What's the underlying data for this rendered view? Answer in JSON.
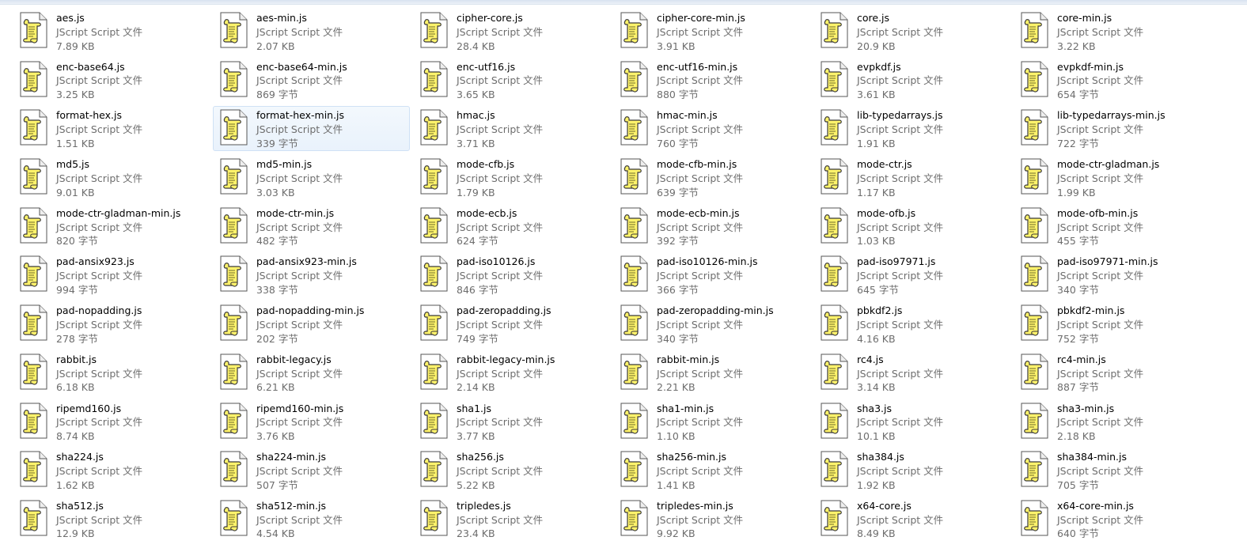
{
  "window": {
    "view": "tiles",
    "selected_index": 13
  },
  "files": [
    {
      "name": "aes.js",
      "type": "JScript Script 文件",
      "size": "7.89 KB"
    },
    {
      "name": "aes-min.js",
      "type": "JScript Script 文件",
      "size": "2.07 KB"
    },
    {
      "name": "cipher-core.js",
      "type": "JScript Script 文件",
      "size": "28.4 KB"
    },
    {
      "name": "cipher-core-min.js",
      "type": "JScript Script 文件",
      "size": "3.91 KB"
    },
    {
      "name": "core.js",
      "type": "JScript Script 文件",
      "size": "20.9 KB"
    },
    {
      "name": "core-min.js",
      "type": "JScript Script 文件",
      "size": "3.22 KB"
    },
    {
      "name": "enc-base64.js",
      "type": "JScript Script 文件",
      "size": "3.25 KB"
    },
    {
      "name": "enc-base64-min.js",
      "type": "JScript Script 文件",
      "size": "869 字节"
    },
    {
      "name": "enc-utf16.js",
      "type": "JScript Script 文件",
      "size": "3.65 KB"
    },
    {
      "name": "enc-utf16-min.js",
      "type": "JScript Script 文件",
      "size": "880 字节"
    },
    {
      "name": "evpkdf.js",
      "type": "JScript Script 文件",
      "size": "3.61 KB"
    },
    {
      "name": "evpkdf-min.js",
      "type": "JScript Script 文件",
      "size": "654 字节"
    },
    {
      "name": "format-hex.js",
      "type": "JScript Script 文件",
      "size": "1.51 KB"
    },
    {
      "name": "format-hex-min.js",
      "type": "JScript Script 文件",
      "size": "339 字节"
    },
    {
      "name": "hmac.js",
      "type": "JScript Script 文件",
      "size": "3.71 KB"
    },
    {
      "name": "hmac-min.js",
      "type": "JScript Script 文件",
      "size": "760 字节"
    },
    {
      "name": "lib-typedarrays.js",
      "type": "JScript Script 文件",
      "size": "1.91 KB"
    },
    {
      "name": "lib-typedarrays-min.js",
      "type": "JScript Script 文件",
      "size": "722 字节"
    },
    {
      "name": "md5.js",
      "type": "JScript Script 文件",
      "size": "9.01 KB"
    },
    {
      "name": "md5-min.js",
      "type": "JScript Script 文件",
      "size": "3.03 KB"
    },
    {
      "name": "mode-cfb.js",
      "type": "JScript Script 文件",
      "size": "1.79 KB"
    },
    {
      "name": "mode-cfb-min.js",
      "type": "JScript Script 文件",
      "size": "639 字节"
    },
    {
      "name": "mode-ctr.js",
      "type": "JScript Script 文件",
      "size": "1.17 KB"
    },
    {
      "name": "mode-ctr-gladman.js",
      "type": "JScript Script 文件",
      "size": "1.99 KB"
    },
    {
      "name": "mode-ctr-gladman-min.js",
      "type": "JScript Script 文件",
      "size": "820 字节"
    },
    {
      "name": "mode-ctr-min.js",
      "type": "JScript Script 文件",
      "size": "482 字节"
    },
    {
      "name": "mode-ecb.js",
      "type": "JScript Script 文件",
      "size": "624 字节"
    },
    {
      "name": "mode-ecb-min.js",
      "type": "JScript Script 文件",
      "size": "392 字节"
    },
    {
      "name": "mode-ofb.js",
      "type": "JScript Script 文件",
      "size": "1.03 KB"
    },
    {
      "name": "mode-ofb-min.js",
      "type": "JScript Script 文件",
      "size": "455 字节"
    },
    {
      "name": "pad-ansix923.js",
      "type": "JScript Script 文件",
      "size": "994 字节"
    },
    {
      "name": "pad-ansix923-min.js",
      "type": "JScript Script 文件",
      "size": "338 字节"
    },
    {
      "name": "pad-iso10126.js",
      "type": "JScript Script 文件",
      "size": "846 字节"
    },
    {
      "name": "pad-iso10126-min.js",
      "type": "JScript Script 文件",
      "size": "366 字节"
    },
    {
      "name": "pad-iso97971.js",
      "type": "JScript Script 文件",
      "size": "645 字节"
    },
    {
      "name": "pad-iso97971-min.js",
      "type": "JScript Script 文件",
      "size": "340 字节"
    },
    {
      "name": "pad-nopadding.js",
      "type": "JScript Script 文件",
      "size": "278 字节"
    },
    {
      "name": "pad-nopadding-min.js",
      "type": "JScript Script 文件",
      "size": "202 字节"
    },
    {
      "name": "pad-zeropadding.js",
      "type": "JScript Script 文件",
      "size": "749 字节"
    },
    {
      "name": "pad-zeropadding-min.js",
      "type": "JScript Script 文件",
      "size": "340 字节"
    },
    {
      "name": "pbkdf2.js",
      "type": "JScript Script 文件",
      "size": "4.16 KB"
    },
    {
      "name": "pbkdf2-min.js",
      "type": "JScript Script 文件",
      "size": "752 字节"
    },
    {
      "name": "rabbit.js",
      "type": "JScript Script 文件",
      "size": "6.18 KB"
    },
    {
      "name": "rabbit-legacy.js",
      "type": "JScript Script 文件",
      "size": "6.21 KB"
    },
    {
      "name": "rabbit-legacy-min.js",
      "type": "JScript Script 文件",
      "size": "2.14 KB"
    },
    {
      "name": "rabbit-min.js",
      "type": "JScript Script 文件",
      "size": "2.21 KB"
    },
    {
      "name": "rc4.js",
      "type": "JScript Script 文件",
      "size": "3.14 KB"
    },
    {
      "name": "rc4-min.js",
      "type": "JScript Script 文件",
      "size": "887 字节"
    },
    {
      "name": "ripemd160.js",
      "type": "JScript Script 文件",
      "size": "8.74 KB"
    },
    {
      "name": "ripemd160-min.js",
      "type": "JScript Script 文件",
      "size": "3.76 KB"
    },
    {
      "name": "sha1.js",
      "type": "JScript Script 文件",
      "size": "3.77 KB"
    },
    {
      "name": "sha1-min.js",
      "type": "JScript Script 文件",
      "size": "1.10 KB"
    },
    {
      "name": "sha3.js",
      "type": "JScript Script 文件",
      "size": "10.1 KB"
    },
    {
      "name": "sha3-min.js",
      "type": "JScript Script 文件",
      "size": "2.18 KB"
    },
    {
      "name": "sha224.js",
      "type": "JScript Script 文件",
      "size": "1.62 KB"
    },
    {
      "name": "sha224-min.js",
      "type": "JScript Script 文件",
      "size": "507 字节"
    },
    {
      "name": "sha256.js",
      "type": "JScript Script 文件",
      "size": "5.22 KB"
    },
    {
      "name": "sha256-min.js",
      "type": "JScript Script 文件",
      "size": "1.41 KB"
    },
    {
      "name": "sha384.js",
      "type": "JScript Script 文件",
      "size": "1.92 KB"
    },
    {
      "name": "sha384-min.js",
      "type": "JScript Script 文件",
      "size": "705 字节"
    },
    {
      "name": "sha512.js",
      "type": "JScript Script 文件",
      "size": "12.9 KB"
    },
    {
      "name": "sha512-min.js",
      "type": "JScript Script 文件",
      "size": "4.54 KB"
    },
    {
      "name": "tripledes.js",
      "type": "JScript Script 文件",
      "size": "23.4 KB"
    },
    {
      "name": "tripledes-min.js",
      "type": "JScript Script 文件",
      "size": "9.92 KB"
    },
    {
      "name": "x64-core.js",
      "type": "JScript Script 文件",
      "size": "8.49 KB"
    },
    {
      "name": "x64-core-min.js",
      "type": "JScript Script 文件",
      "size": "640 字节"
    }
  ],
  "icon": "jscript-file-icon",
  "colors": {
    "selection_bg": "#e9f2fc",
    "selection_border": "#cfe1f5",
    "secondary_text": "#6d6d6d"
  }
}
